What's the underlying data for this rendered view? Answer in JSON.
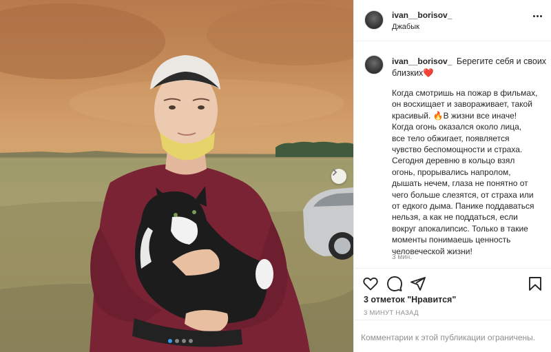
{
  "post": {
    "username": "ivan__borisov_",
    "location": "Джабык",
    "more_icon": "more-options-icon"
  },
  "caption": {
    "first_line": "Берегите себя и своих близких",
    "heart_emoji": "❤️",
    "body": "Когда смотришь на пожар в фильмах,\nон восхищает и завораживает, такой\nкрасивый. 🔥В жизни все иначе!\nКогда огонь оказался около лица,\nвсе тело обжигает, появляется\nчувство беспомощности и страха.\nСегодня деревню в кольцо взял\nогонь, прорывались напролом,\nдышать нечем, глаза не понятно от\nчего больше слезятся, от страха или\nот едкого дыма. Панике поддаваться\nнельзя, а как не поддаться, если\nвокруг апокалипсис. Только в такие\nмоменты понимаешь ценность\nчеловеческой жизни!",
    "time": "3 мин."
  },
  "actions": {
    "likes": "3 отметок \"Нравится\"",
    "post_time": "3 МИНУТ НАЗАД",
    "icons": [
      "heart-icon",
      "comment-icon",
      "share-icon",
      "bookmark-icon"
    ]
  },
  "comments_disabled": "Комментарии к этой публикации ограничены.",
  "carousel": {
    "slide_count": 4,
    "active_slide": 1
  },
  "colors": {
    "carousel_active_dot": "#3897f0",
    "heart": "#ed4956",
    "muted_text": "#8e8e8e"
  }
}
